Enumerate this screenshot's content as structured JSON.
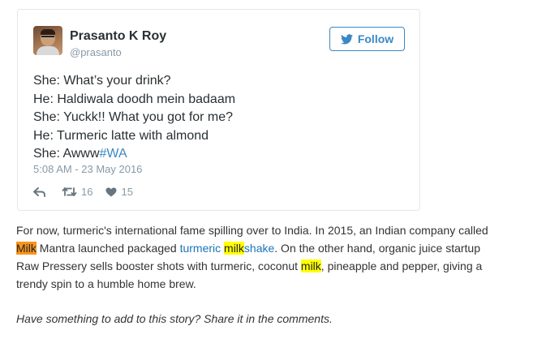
{
  "tweet": {
    "display_name": "Prasanto K Roy",
    "screen_name": "@prasanto",
    "follow_label": "Follow",
    "lines": [
      "She: What’s your drink?",
      "He: Haldiwala doodh mein badaam",
      "She: Yuckk!! What you got for me?",
      "He: Turmeric latte with almond"
    ],
    "last_line_text": "She: Awww",
    "hashtag": "#WA",
    "timestamp": "5:08 AM - 23 May 2016",
    "retweet_count": "16",
    "like_count": "15"
  },
  "article": {
    "p1_line1": "For now, turmeric's international fame spilling over to India. In 2015, an Indian company called",
    "p1_brand_highlight": "Milk",
    "p1_line2_rest": " Mantra launched packaged ",
    "p1_link_part1": "turmeric ",
    "p1_link_highlight": "milk",
    "p1_link_part2": "shake",
    "p1_line2_end": ". On the other hand, organic juice startup",
    "p1_line3_start": "Raw Pressery sells booster shots with turmeric, coconut ",
    "p1_line3_highlight": "milk",
    "p1_line3_end": ", pineapple and pepper, giving a",
    "p1_line4": "trendy spin to a humble home brew.",
    "closing": "Have something to add to this story? Share it in the comments."
  },
  "colors": {
    "link": "#1a75b7",
    "twitter_blue": "#3b88c3",
    "highlight_orange": "#f7951d",
    "highlight_yellow": "#ffff00"
  },
  "icons": {
    "follow": "twitter-bird-icon",
    "reply": "reply-icon",
    "retweet": "retweet-icon",
    "like": "heart-icon"
  }
}
